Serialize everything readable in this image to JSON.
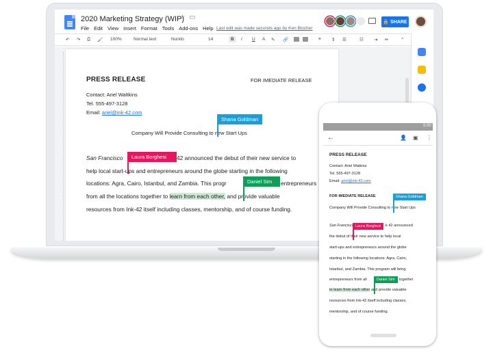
{
  "doc": {
    "title": "2020 Marketing Strategy (WIP)",
    "menu": [
      "File",
      "Edit",
      "View",
      "Insert",
      "Format",
      "Tools",
      "Add-ons",
      "Help"
    ],
    "last_edit": "Last edit was made seconds ago by Ken Blocher",
    "share_label": "SHARE"
  },
  "toolbar": {
    "zoom": "100%",
    "style": "Normal text",
    "font": "Nunito",
    "size": "14",
    "bold": "B",
    "italic": "I",
    "underline": "U",
    "text_color": "A"
  },
  "release": {
    "title": "PRESS RELEASE",
    "imediate": "FOR IMEDIATE RELEASE",
    "contact": "Contact: Ariel Waltkins",
    "tel": "Tel. 555-497-3128",
    "email_label": "Email: ",
    "email": "ariel@ink-42.com",
    "subtitle_a": "Company Will Provide Consulting",
    "subtitle_b": "to new Start Ups",
    "line1_city": "San Francisco",
    "line1_rest": "42 announced the debut of their new service to",
    "line2": "help local start-ups and entrepreneurs around the globe starting in the following",
    "line3_a": "locations: Agra, Cairo, Istanbul, and Zambia. This progr",
    "line3_b": "entrepreneurs",
    "line4_a": "from all the locations together to",
    "line4_hl": "learn from each other,",
    "line4_b": "and provide valuable",
    "line5": "resources from Ink-42 itself including classes, mentorship, and of course funding."
  },
  "collaborators": {
    "shana": "Shana Goldman",
    "laura": "Laura Borghesi",
    "daniel": "Daniel Sim"
  },
  "phone": {
    "time": "5:00",
    "title": "PRESS RELEASE",
    "contact": "Contact: Ariel Watkins",
    "tel": "Tel. 555-497-3128",
    "email_label": "Email: ",
    "email": "ariel@ink-42.com",
    "imediate": "FOR IMEDIATE RELEASE",
    "subtitle": "Company Will Provide Consulting to new Start Ups",
    "l1_city": "San Francisco",
    "l1_rest": "k 42 announced",
    "l2": "the debut of their new service to help local",
    "l3": "start-ups and entrepreneurs around the globe",
    "l4": "starting in the following locations: Agra, Cairo,",
    "l5": "Istanbul, and Zambia. This program will bring",
    "l6_a": "entrepreneurs from all",
    "l6_b": "together",
    "l7_hl": "to learn from each other",
    "l7_b": " and provide valuable",
    "l8": "resources from Ink-42 itself including classes,",
    "l9": "mentorship, and of course funding."
  },
  "colors": {
    "shana": "#1a9fd9",
    "laura": "#e8175d",
    "daniel": "#0f9d58"
  }
}
